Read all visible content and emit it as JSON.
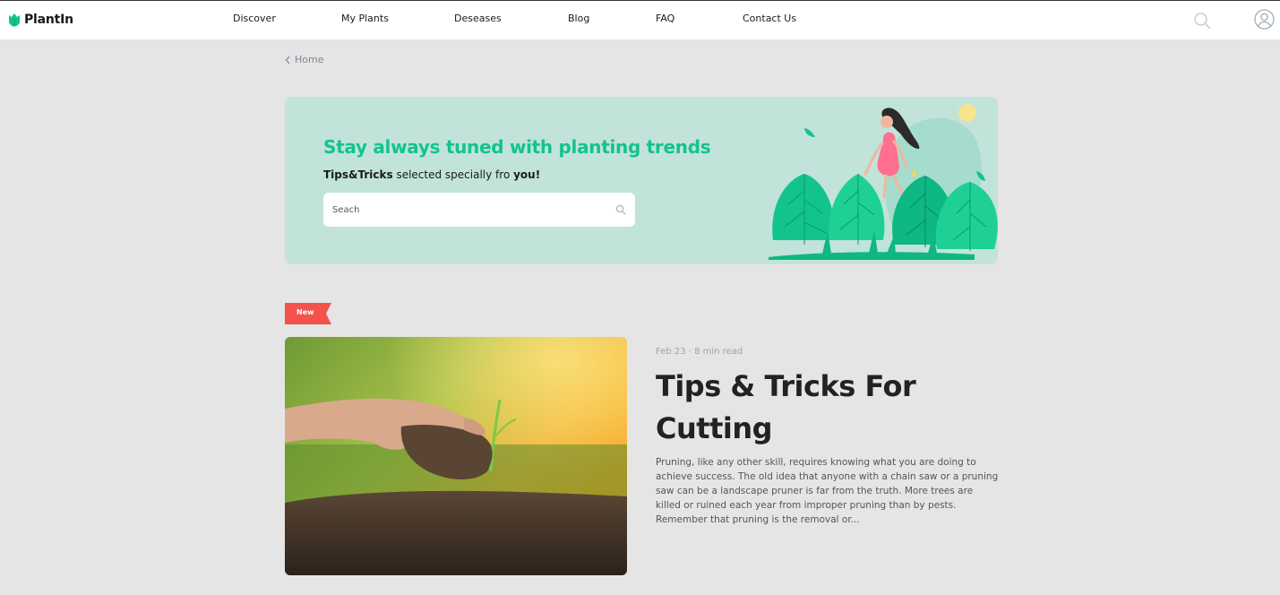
{
  "brand": {
    "name": "PlantIn",
    "color": "#12c48c"
  },
  "nav": {
    "items": [
      {
        "label": "Discover"
      },
      {
        "label": "My Plants"
      },
      {
        "label": "Deseases"
      },
      {
        "label": "Blog"
      },
      {
        "label": "FAQ"
      },
      {
        "label": "Contact Us"
      }
    ],
    "icons": [
      "search-icon",
      "user-icon"
    ]
  },
  "breadcrumb": {
    "label": "Home",
    "icon": "chevron-left-icon"
  },
  "hero": {
    "title": "Stay always tuned with planting trends",
    "subtitle_bold1": "Tips&Tricks",
    "subtitle_mid": " selected specially fro ",
    "subtitle_bold2": "you!",
    "search_placeholder": "Seach",
    "background": "#c1e3da",
    "title_color": "#12c48c"
  },
  "article": {
    "badge": "New",
    "badge_color": "#f4524d",
    "meta": "Feb 23 · 8 min read",
    "title": "Tips & Tricks For Cutting",
    "excerpt": "Pruning, like any other skill, requires knowing what you are doing to achieve success. The old idea that anyone with a chain saw or a pruning saw can be a landscape pruner is far from the truth. More trees are killed or ruined each year from improper pruning than by pests. Remember that pruning is the removal or..."
  }
}
